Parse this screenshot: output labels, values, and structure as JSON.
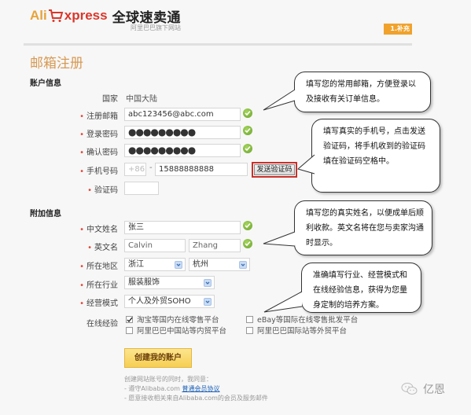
{
  "header": {
    "logo_ali": "Ali",
    "logo_xpress": "xpress",
    "logo_cn": "全球速卖通",
    "logo_sub": "阿里巴巴旗下网站",
    "step_badge": "1.补充",
    "brand_colors": {
      "orange": "#e8a33a",
      "red": "#d9372b"
    }
  },
  "page_title": "邮箱注册",
  "account": {
    "section_title": "账户信息",
    "country": {
      "label": "国家",
      "value": "中国大陆"
    },
    "email": {
      "label": "注册邮箱",
      "value": "abc123456@abc.com",
      "valid": true
    },
    "password": {
      "label": "登录密码",
      "value": "●●●●●●●●●",
      "valid": true
    },
    "confirm_password": {
      "label": "确认密码",
      "value": "●●●●●●●●●",
      "valid": true
    },
    "phone": {
      "label": "手机号码",
      "country_code": "+86",
      "separator": "-",
      "value": "15888888888"
    },
    "send_code_button": "发送验证码",
    "code": {
      "label": "验证码",
      "value": ""
    }
  },
  "extra": {
    "section_title": "附加信息",
    "chinese_name": {
      "label": "中文姓名",
      "value": "张三",
      "valid": true
    },
    "english_name": {
      "label": "英文名",
      "first": "Calvin",
      "last": "Zhang",
      "valid": true
    },
    "region": {
      "label": "所在地区",
      "province": "浙江",
      "city": "杭州"
    },
    "industry": {
      "label": "所在行业",
      "value": "服装服饰"
    },
    "business_mode": {
      "label": "经营模式",
      "value": "个人及外贸SOHO"
    },
    "experience": {
      "label": "在线经验",
      "options": [
        {
          "label": "淘宝等国内在线零售平台",
          "checked": true
        },
        {
          "label": "eBay等国际在线零售批发平台",
          "checked": false
        },
        {
          "label": "阿里巴巴中国站等内贸平台",
          "checked": false
        },
        {
          "label": "阿里巴巴国际站等外贸平台",
          "checked": false
        }
      ]
    }
  },
  "create_button": "创建我的账户",
  "terms": {
    "intro": "创建网站账号的同时，我同意：",
    "line1_prefix": "- 遵守Alibaba.com ",
    "line1_link": "普通会员协议",
    "line2": "- 愿意接收相关来自Alibaba.com的会员及服务邮件"
  },
  "callouts": [
    {
      "text": "填写您的常用邮箱，方便登录以及接收有关订单信息。"
    },
    {
      "text": "填写真实的手机号，点击发送验证码，将手机收到的验证码填在验证码空格中。"
    },
    {
      "text": "填写您的真实姓名，以便成单后顺利收款。英文名将在您与卖家沟通时显示。"
    },
    {
      "text": "准确填写行业、经营模式和在线经验信息，获得为您量身定制的培养方案。"
    }
  ],
  "watermark": "亿恩"
}
